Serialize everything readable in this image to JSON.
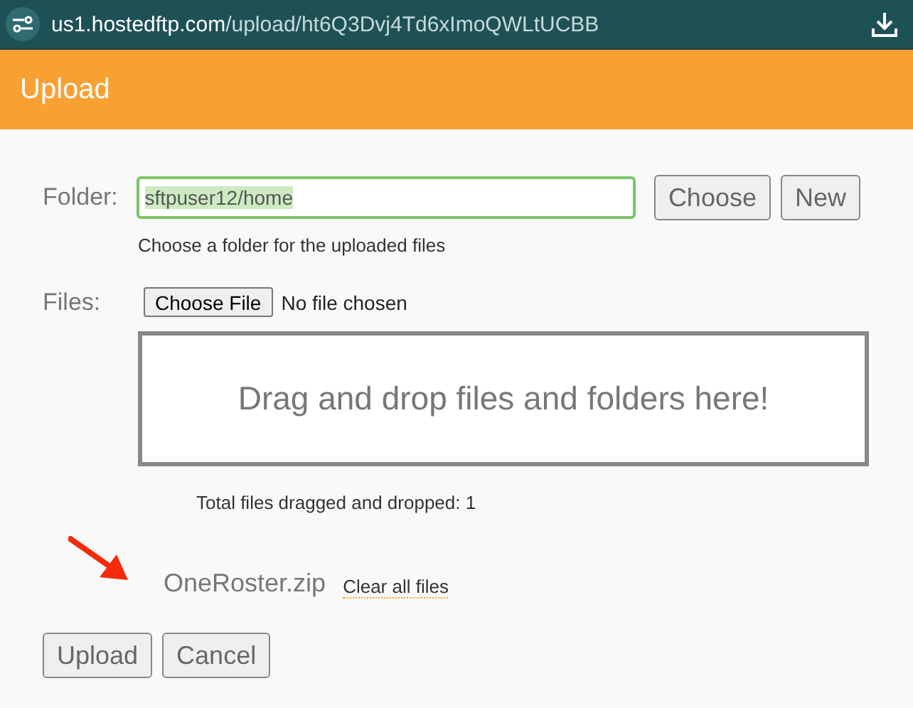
{
  "address_bar": {
    "host": "us1.hostedftp.com",
    "path": "/upload/ht6Q3Dvj4Td6xImoQWLtUCBB"
  },
  "header": {
    "title": "Upload"
  },
  "folder": {
    "label": "Folder:",
    "value": "sftpuser12/home",
    "buttons": [
      "Choose",
      "New"
    ],
    "hint": "Choose a folder for the uploaded files"
  },
  "files": {
    "label": "Files:",
    "button": "Choose File",
    "status": "No file chosen",
    "drop_zone": "Drag and drop files and folders here!",
    "total": "Total files dragged and dropped: 1"
  },
  "file_list": [
    {
      "name": "OneRoster.zip"
    }
  ],
  "clear_link": "Clear all files",
  "actions": [
    "Upload",
    "Cancel"
  ]
}
